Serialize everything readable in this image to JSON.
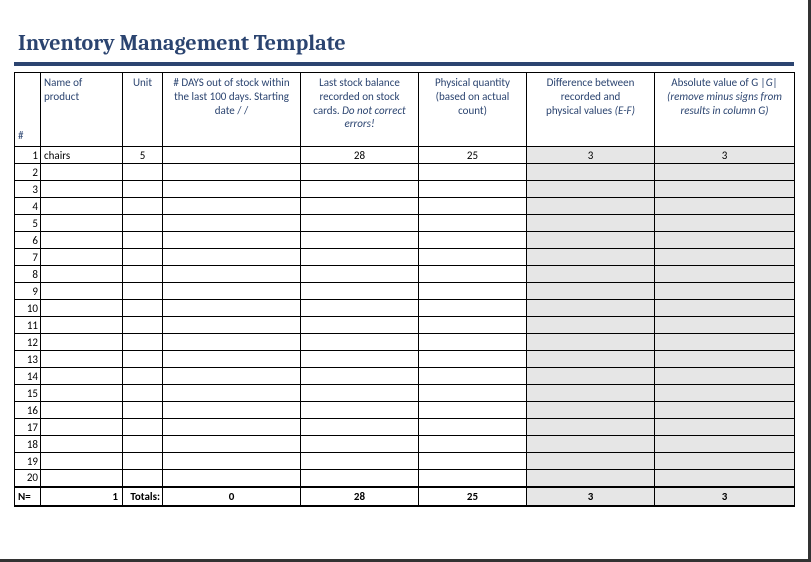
{
  "title": "Inventory Management Template",
  "headers": {
    "num": "#",
    "name": "Name of product",
    "unit": "Unit",
    "days_l1": "# DAYS out of stock within",
    "days_l2": "the last 100 days. Starting",
    "days_l3": "date   /  /",
    "bal_l1": "Last stock balance",
    "bal_l2": "recorded on stock",
    "bal_l3": "cards.",
    "bal_em": "Do not correct errors!",
    "phys_l1": "Physical quantity",
    "phys_l2": "(based on actual",
    "phys_l3": "count)",
    "diff_l1": "Difference between",
    "diff_l2": "recorded and",
    "diff_l3": "physical values",
    "diff_em": "(E-F)",
    "abs_l1": "Absolute value of G",
    "abs_em1": "|G|",
    "abs_l2": "(remove minus signs from results in column G)"
  },
  "rows": [
    {
      "n": "1",
      "name": "chairs",
      "unit": "5",
      "days": "",
      "bal": "28",
      "phys": "25",
      "diff": "3",
      "abs": "3"
    },
    {
      "n": "2",
      "name": "",
      "unit": "",
      "days": "",
      "bal": "",
      "phys": "",
      "diff": "",
      "abs": ""
    },
    {
      "n": "3",
      "name": "",
      "unit": "",
      "days": "",
      "bal": "",
      "phys": "",
      "diff": "",
      "abs": ""
    },
    {
      "n": "4",
      "name": "",
      "unit": "",
      "days": "",
      "bal": "",
      "phys": "",
      "diff": "",
      "abs": ""
    },
    {
      "n": "5",
      "name": "",
      "unit": "",
      "days": "",
      "bal": "",
      "phys": "",
      "diff": "",
      "abs": ""
    },
    {
      "n": "6",
      "name": "",
      "unit": "",
      "days": "",
      "bal": "",
      "phys": "",
      "diff": "",
      "abs": ""
    },
    {
      "n": "7",
      "name": "",
      "unit": "",
      "days": "",
      "bal": "",
      "phys": "",
      "diff": "",
      "abs": ""
    },
    {
      "n": "8",
      "name": "",
      "unit": "",
      "days": "",
      "bal": "",
      "phys": "",
      "diff": "",
      "abs": ""
    },
    {
      "n": "9",
      "name": "",
      "unit": "",
      "days": "",
      "bal": "",
      "phys": "",
      "diff": "",
      "abs": ""
    },
    {
      "n": "10",
      "name": "",
      "unit": "",
      "days": "",
      "bal": "",
      "phys": "",
      "diff": "",
      "abs": ""
    },
    {
      "n": "11",
      "name": "",
      "unit": "",
      "days": "",
      "bal": "",
      "phys": "",
      "diff": "",
      "abs": ""
    },
    {
      "n": "12",
      "name": "",
      "unit": "",
      "days": "",
      "bal": "",
      "phys": "",
      "diff": "",
      "abs": ""
    },
    {
      "n": "13",
      "name": "",
      "unit": "",
      "days": "",
      "bal": "",
      "phys": "",
      "diff": "",
      "abs": ""
    },
    {
      "n": "14",
      "name": "",
      "unit": "",
      "days": "",
      "bal": "",
      "phys": "",
      "diff": "",
      "abs": ""
    },
    {
      "n": "15",
      "name": "",
      "unit": "",
      "days": "",
      "bal": "",
      "phys": "",
      "diff": "",
      "abs": ""
    },
    {
      "n": "16",
      "name": "",
      "unit": "",
      "days": "",
      "bal": "",
      "phys": "",
      "diff": "",
      "abs": ""
    },
    {
      "n": "17",
      "name": "",
      "unit": "",
      "days": "",
      "bal": "",
      "phys": "",
      "diff": "",
      "abs": ""
    },
    {
      "n": "18",
      "name": "",
      "unit": "",
      "days": "",
      "bal": "",
      "phys": "",
      "diff": "",
      "abs": ""
    },
    {
      "n": "19",
      "name": "",
      "unit": "",
      "days": "",
      "bal": "",
      "phys": "",
      "diff": "",
      "abs": ""
    },
    {
      "n": "20",
      "name": "",
      "unit": "",
      "days": "",
      "bal": "",
      "phys": "",
      "diff": "",
      "abs": ""
    }
  ],
  "totals": {
    "n_label": "N=",
    "n_value": "1",
    "totals_label": "Totals:",
    "days": "0",
    "bal": "28",
    "phys": "25",
    "diff": "3",
    "abs": "3"
  }
}
